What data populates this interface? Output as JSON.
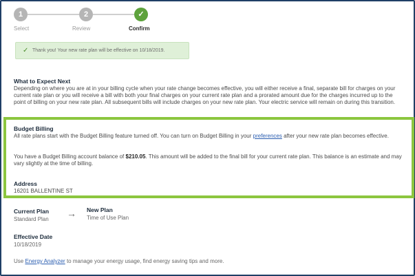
{
  "stepper": {
    "steps": [
      {
        "number": "1",
        "label": "Select"
      },
      {
        "number": "2",
        "label": "Review"
      },
      {
        "number": "✓",
        "label": "Confirm"
      }
    ]
  },
  "banner": {
    "message": "Thank you! Your new rate plan will be effective on 10/18/2019."
  },
  "expect": {
    "title": "What to Expect Next",
    "body": "Depending on where you are at in your billing cycle when your rate change becomes effective, you will either receive a final, separate bill for charges on your current rate plan or you will receive a bill with both your final charges on your current rate plan and a prorated amount due for the charges incurred up to the point of billing on your new rate plan. All subsequent bills will include charges on your new rate plan. Your electric service will remain on during this transition."
  },
  "budget": {
    "title": "Budget Billing",
    "p1_before": "All rate plans start with the Budget Billing feature turned off. You can turn on Budget Billing in your ",
    "p1_link": "preferences",
    "p1_after": " after your new rate plan becomes effective.",
    "p2_before": "You have a Budget Billing account balance of ",
    "p2_amount": "$210.05",
    "p2_after": ". This amount will be added to the final bill for your current rate plan. This balance is an estimate and may vary slightly at the time of billing."
  },
  "address": {
    "title": "Address",
    "value": "16201 BALLENTINE ST"
  },
  "plans": {
    "current_label": "Current Plan",
    "current_value": "Standard Plan",
    "new_label": "New Plan",
    "new_value": "Time of Use Plan",
    "arrow": "→"
  },
  "effective": {
    "label": "Effective Date",
    "value": "10/18/2019"
  },
  "footer": {
    "before": "Use ",
    "link": "Energy Analyzer",
    "after": " to manage your energy usage, find energy saving tips and more."
  },
  "colors": {
    "highlight": "#8cc63f",
    "frame": "#1f3f66",
    "success_bg": "#dff0d8",
    "step_active": "#5da23c"
  }
}
